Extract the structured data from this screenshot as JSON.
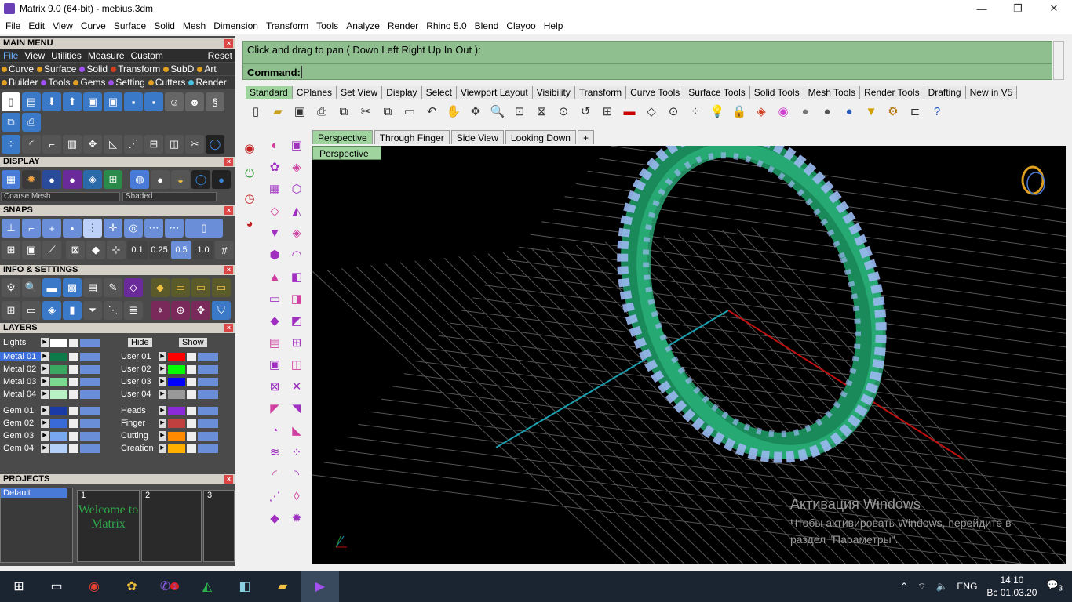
{
  "window": {
    "title": "Matrix 9.0 (64-bit) - mebius.3dm",
    "minimize": "—",
    "restore": "❐",
    "close": "✕"
  },
  "menubar": [
    "File",
    "Edit",
    "View",
    "Curve",
    "Surface",
    "Solid",
    "Mesh",
    "Dimension",
    "Transform",
    "Tools",
    "Analyze",
    "Render",
    "Rhino 5.0",
    "Blend",
    "Clayoo",
    "Help"
  ],
  "left": {
    "main_menu": "MAIN MENU",
    "cats": [
      "File",
      "View",
      "Utilities",
      "Measure",
      "Custom",
      "Reset"
    ],
    "sub1": [
      "Curve",
      "Surface",
      "Solid",
      "Transform",
      "SubD",
      "Art"
    ],
    "sub2": [
      "Builder",
      "Tools",
      "Gems",
      "Setting",
      "Cutters",
      "Render"
    ],
    "display": "DISPLAY",
    "display_mode1": "Coarse Mesh",
    "display_mode2": "Shaded",
    "snaps": "SNAPS",
    "snap_values": [
      "0.1",
      "0.25",
      "0.5",
      "1.0"
    ],
    "info": "INFO & SETTINGS",
    "layers": "LAYERS",
    "layer_lights": "Lights",
    "hide": "Hide",
    "show": "Show",
    "layers_left": [
      {
        "name": "Metal 01",
        "color": "#0e7a4a"
      },
      {
        "name": "Metal 02",
        "color": "#3aa860"
      },
      {
        "name": "Metal 03",
        "color": "#7ad890"
      },
      {
        "name": "Metal 04",
        "color": "#b8f0c4"
      },
      {
        "name": "Gem 01",
        "color": "#1a3aa8"
      },
      {
        "name": "Gem 02",
        "color": "#3a6ad8"
      },
      {
        "name": "Gem 03",
        "color": "#7aa8f0"
      },
      {
        "name": "Gem 04",
        "color": "#b4d0f8"
      }
    ],
    "layers_right": [
      {
        "name": "User 01",
        "color": "#ff0000"
      },
      {
        "name": "User 02",
        "color": "#00ff00"
      },
      {
        "name": "User 03",
        "color": "#0000ff"
      },
      {
        "name": "User 04",
        "color": "#999999"
      },
      {
        "name": "Heads",
        "color": "#8a2ad8"
      },
      {
        "name": "Finger",
        "color": "#c04040"
      },
      {
        "name": "Cutting",
        "color": "#ff8a00"
      },
      {
        "name": "Creation",
        "color": "#ffb000"
      }
    ],
    "projects": "PROJECTS",
    "project_default": "Default",
    "project_slots": [
      "1",
      "2",
      "3"
    ],
    "welcome": "Welcome to Matrix"
  },
  "command": {
    "prompt": "Click and drag to pan ( Down  Left  Right  Up  In  Out ):",
    "label": "Command:"
  },
  "tabs": [
    "Standard",
    "CPlanes",
    "Set View",
    "Display",
    "Select",
    "Viewport Layout",
    "Visibility",
    "Transform",
    "Curve Tools",
    "Surface Tools",
    "Solid Tools",
    "Mesh Tools",
    "Render Tools",
    "Drafting",
    "New in V5"
  ],
  "viewport_tabs": [
    "Perspective",
    "Through Finger",
    "Side View",
    "Looking Down"
  ],
  "viewport_label": "Perspective",
  "watermark": {
    "title": "Активация Windows",
    "body": "Чтобы активировать Windows, перейдите в раздел \"Параметры\"."
  },
  "taskbar": {
    "lang": "ENG",
    "time": "14:10",
    "date": "Вс 01.03.20",
    "notif": "3",
    "viber_badge": "1"
  }
}
